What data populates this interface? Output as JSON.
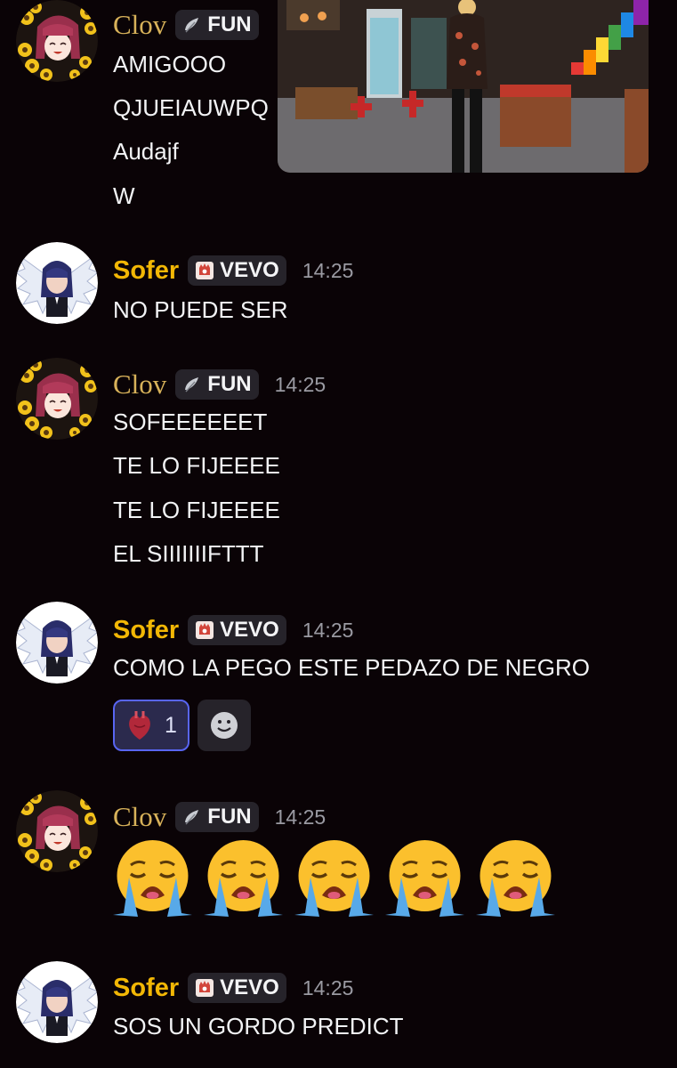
{
  "users": {
    "clov": {
      "name": "Clov",
      "badge": "FUN"
    },
    "sofer": {
      "name": "Sofer",
      "badge": "VEVO"
    }
  },
  "messages": [
    {
      "id": "m1",
      "lines": [
        "AMIGOOO",
        "QJUEIAUWPQ",
        "Audajf",
        "W"
      ]
    },
    {
      "id": "m2",
      "time": "14:25",
      "lines": [
        "NO PUEDE SER"
      ]
    },
    {
      "id": "m3",
      "time": "14:25",
      "lines": [
        "SOFEEEEEET",
        "TE LO FIJEEEE",
        "TE LO FIJEEEE",
        "EL SIIIIIIIFTTT"
      ]
    },
    {
      "id": "m4",
      "time": "14:25",
      "lines": [
        "COMO LA PEGO ESTE PEDAZO DE NEGRO"
      ],
      "reaction": {
        "emoji": "anatomical-heart",
        "count": "1"
      },
      "add_reaction_icon": "smile-icon"
    },
    {
      "id": "m5",
      "time": "14:25",
      "emoji_icon": "loudly-crying-face-icon"
    },
    {
      "id": "m6",
      "time": "14:25",
      "lines": [
        "SOS UN GORDO PREDICT"
      ]
    }
  ],
  "colors": {
    "background": "#0a0306",
    "clov_name": "#d8b25a",
    "sofer_name": "#f2b705",
    "badge_bg": "#26232a",
    "timestamp": "#9a9aa2",
    "reaction_border": "#5865f2"
  }
}
